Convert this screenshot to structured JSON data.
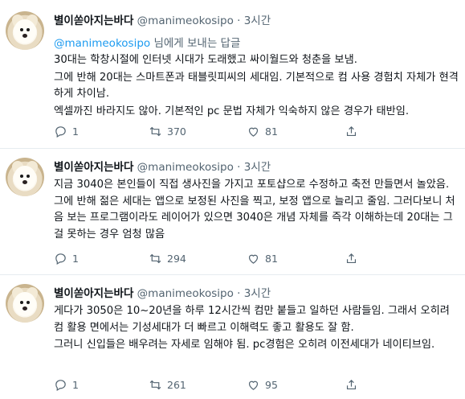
{
  "tweets": [
    {
      "name": "별이쏟아지는바다",
      "handle": "@manimeokosipo",
      "dot": "·",
      "time": "3시간",
      "replying_mention": "@manimeokosipo",
      "replying_suffix": " 님에게 보내는 답글",
      "lines": [
        "30대는 학창시절에 인터넷 시대가 도래했고 싸이월드와 청춘을 보냄.",
        "그에 반해 20대는 스마트폰과 태블릿피씨의 세대임. 기본적으로 컴 사용 경험치 자체가 현격하게 차이남.",
        "엑셀까진 바라지도 않아. 기본적인 pc 문법 자체가 익숙하지 않은 경우가 태반임."
      ],
      "replies": "1",
      "retweets": "370",
      "likes": "81"
    },
    {
      "name": "별이쏟아지는바다",
      "handle": "@manimeokosipo",
      "dot": "·",
      "time": "3시간",
      "lines": [
        "지금 3040은 본인들이 직접 생사진을 가지고 포토샵으로 수정하고 축전 만들면서 놀았음. 그에 반해 젊은 세대는 앱으로 보정된 사진을 찍고, 보정 앱으로 늘리고 줄임. 그러다보니 처음 보는 프로그램이라도 레이어가 있으면 3040은 개념 자체를 즉각 이해하는데 20대는 그걸 못하는 경우 엄청 많음"
      ],
      "replies": "1",
      "retweets": "294",
      "likes": "81"
    },
    {
      "name": "별이쏟아지는바다",
      "handle": "@manimeokosipo",
      "dot": "·",
      "time": "3시간",
      "lines": [
        "게다가 3050은 10~20년을 하루 12시간씩 컴만 붙들고 일하던 사람들임. 그래서 오히려 컴 활용 면에서는 기성세대가 더 빠르고 이해력도 좋고 활용도 잘 함.",
        "그러니 신입들은 배우려는 자세로 임해야 됨. pc경험은 오히려 이전세대가 네이티브임."
      ],
      "replies": "1",
      "retweets": "261",
      "likes": "95"
    }
  ],
  "icons": {
    "reply": "reply-icon",
    "retweet": "retweet-icon",
    "like": "heart-icon",
    "share": "share-icon"
  },
  "colors": {
    "mention": "#1d9bf0",
    "secondary_text": "#536471",
    "separator": "#e6ecf0"
  }
}
